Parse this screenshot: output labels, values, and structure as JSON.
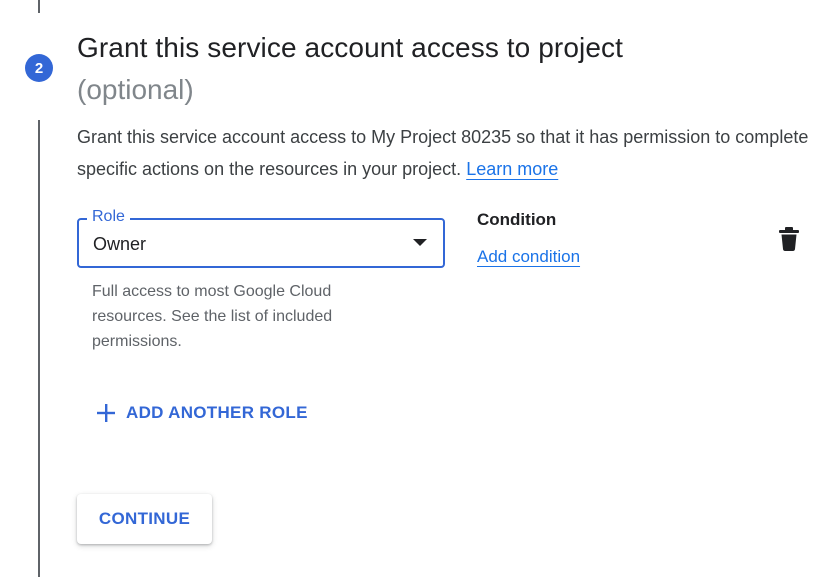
{
  "step": {
    "number": "2",
    "title": "Grant this service account access to project",
    "subtitle": "(optional)"
  },
  "description": {
    "text": "Grant this service account access to My Project 80235 so that it has permission to complete specific actions on the resources in your project. ",
    "link_label": "Learn more"
  },
  "role": {
    "label": "Role",
    "value": "Owner",
    "help": "Full access to most Google Cloud resources. See the list of included permissions."
  },
  "condition": {
    "heading": "Condition",
    "add_label": "Add condition"
  },
  "actions": {
    "add_role_label": "ADD ANOTHER ROLE",
    "continue_label": "CONTINUE"
  },
  "icons": {
    "delete": "trash-icon",
    "add": "plus-icon",
    "dropdown": "caret-down-icon"
  },
  "colors": {
    "accent": "#3367d6",
    "link": "#1a73e8",
    "muted": "#80868b"
  }
}
